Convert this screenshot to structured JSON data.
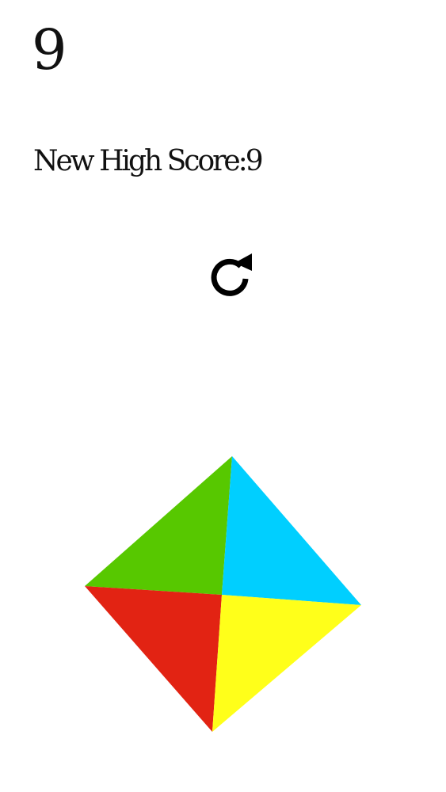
{
  "score": "9",
  "high_score_text": "New High Score:9",
  "icons": {
    "restart": "refresh-icon"
  },
  "colors": {
    "green": "#57c800",
    "blue": "#00cfff",
    "red": "#e22313",
    "yellow": "#ffff1a",
    "text": "#111111",
    "background": "#ffffff"
  }
}
